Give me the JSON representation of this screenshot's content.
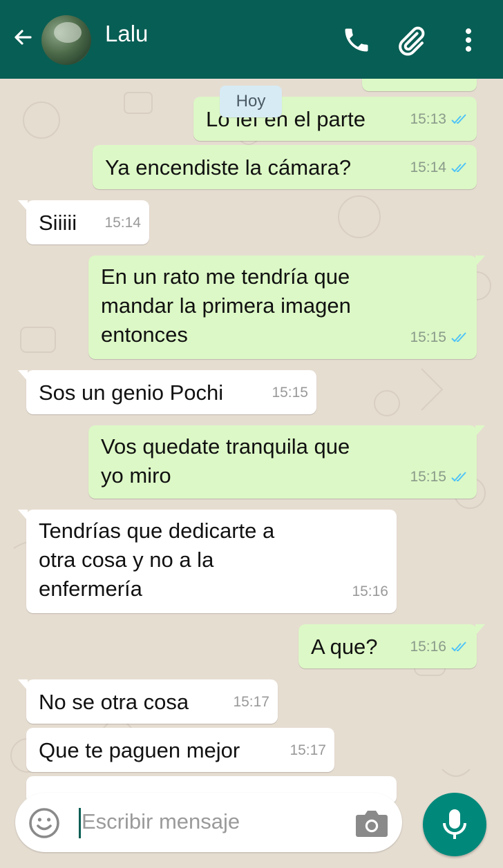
{
  "header": {
    "contact_name": "Lalu",
    "icons": [
      "back-arrow-icon",
      "avatar",
      "phone-icon",
      "paperclip-icon",
      "more-vert-icon"
    ]
  },
  "date_chip": "Hoy",
  "messages": [
    {
      "direction": "out",
      "text": "Lo leí en el parte",
      "time": "15:13",
      "status": "read"
    },
    {
      "direction": "out",
      "text": "Ya encendiste la cámara?",
      "time": "15:14",
      "status": "read"
    },
    {
      "direction": "in",
      "text": "Siiiii",
      "time": "15:14"
    },
    {
      "direction": "out",
      "lines": [
        "En un rato me tendría que",
        "mandar la primera imagen",
        "entonces"
      ],
      "time": "15:15",
      "status": "read"
    },
    {
      "direction": "in",
      "text": "Sos un genio Pochi",
      "time": "15:15"
    },
    {
      "direction": "out",
      "lines": [
        "Vos quedate tranquila que",
        "yo miro"
      ],
      "time": "15:15",
      "status": "read"
    },
    {
      "direction": "in",
      "lines": [
        "Tendrías que dedicarte a",
        "otra cosa y no a la",
        "enfermería"
      ],
      "time": "15:16"
    },
    {
      "direction": "out",
      "text": "A que?",
      "time": "15:16",
      "status": "read"
    },
    {
      "direction": "in",
      "text": "No se otra cosa",
      "time": "15:17"
    },
    {
      "direction": "in",
      "text": "Que te paguen mejor",
      "time": "15:17"
    }
  ],
  "composer": {
    "placeholder": "Escribir mensaje"
  },
  "colors": {
    "header": "#075e54",
    "outgoing": "#dcf8c6",
    "incoming": "#ffffff",
    "read_ticks": "#4fc3f7",
    "mic_button": "#00897b",
    "background": "#e6ddd1"
  }
}
